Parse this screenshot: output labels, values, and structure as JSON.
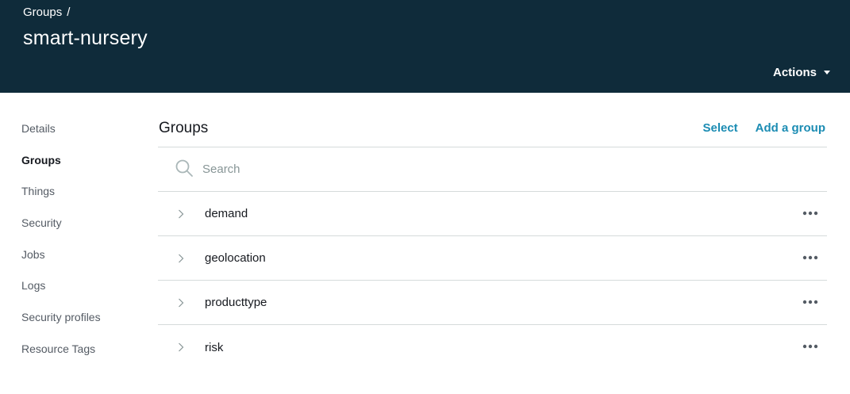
{
  "header": {
    "breadcrumb": {
      "parent": "Groups",
      "separator": "/"
    },
    "title": "smart-nursery",
    "actions_label": "Actions",
    "background_color": "#0f2b3a"
  },
  "sidebar": {
    "items": [
      {
        "label": "Details",
        "active": false
      },
      {
        "label": "Groups",
        "active": true
      },
      {
        "label": "Things",
        "active": false
      },
      {
        "label": "Security",
        "active": false
      },
      {
        "label": "Jobs",
        "active": false
      },
      {
        "label": "Logs",
        "active": false
      },
      {
        "label": "Security profiles",
        "active": false
      },
      {
        "label": "Resource Tags",
        "active": false
      }
    ]
  },
  "main": {
    "title": "Groups",
    "select_label": "Select",
    "add_label": "Add a group",
    "link_color": "#1b8cb3",
    "search": {
      "placeholder": "Search",
      "value": ""
    },
    "groups": [
      {
        "name": "demand"
      },
      {
        "name": "geolocation"
      },
      {
        "name": "producttype"
      },
      {
        "name": "risk"
      }
    ],
    "row_icons": {
      "expand": "chevron-right-icon",
      "menu": "more-options-icon"
    }
  }
}
